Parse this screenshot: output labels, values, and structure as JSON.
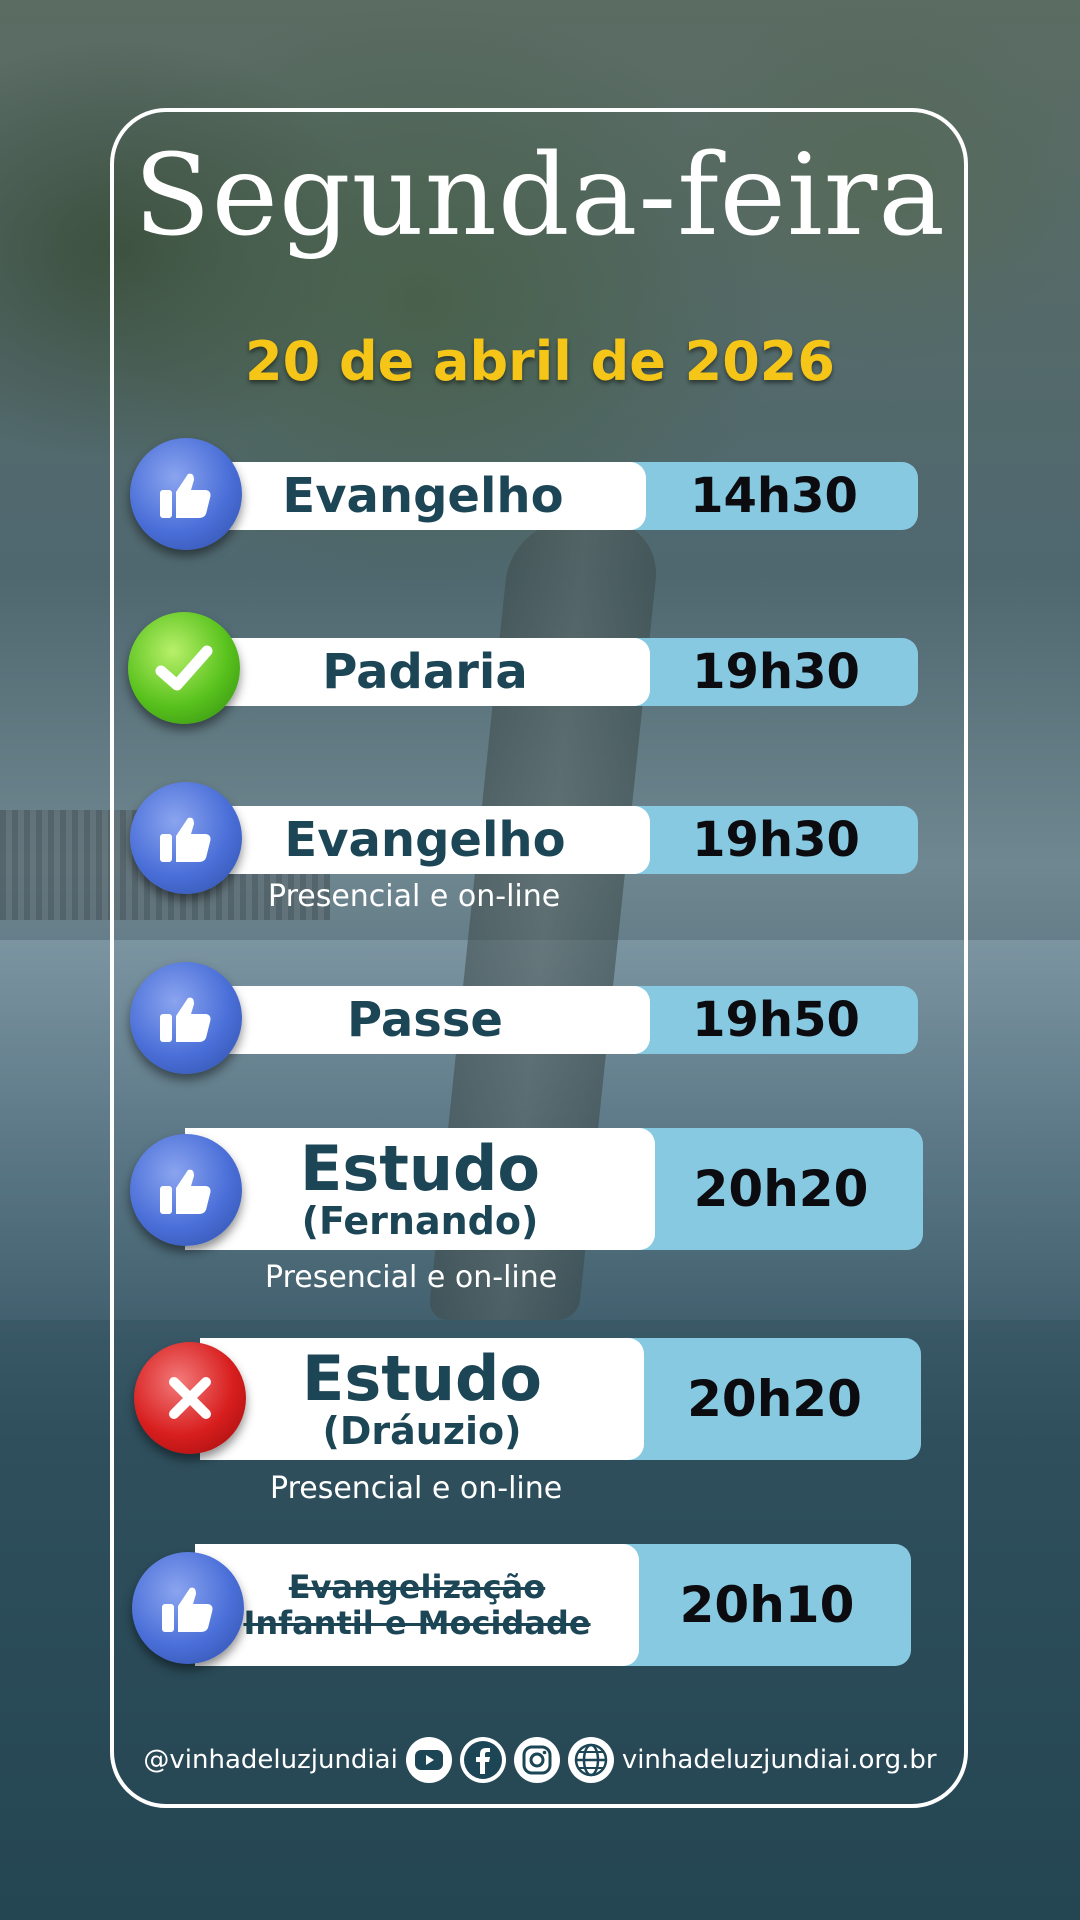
{
  "title": "Segunda-feira",
  "date": "20 de abril de 2026",
  "schedule": [
    {
      "name": "Evangelho",
      "name2": "",
      "time": "14h30",
      "note": "",
      "icon": "thumbs-up-icon"
    },
    {
      "name": "Padaria",
      "name2": "",
      "time": "19h30",
      "note": "",
      "icon": "check-icon"
    },
    {
      "name": "Evangelho",
      "name2": "",
      "time": "19h30",
      "note": "Presencial e on-line",
      "icon": "thumbs-up-icon"
    },
    {
      "name": "Passe",
      "name2": "",
      "time": "19h50",
      "note": "",
      "icon": "thumbs-up-icon"
    },
    {
      "name": "Estudo",
      "name2": "(Fernando)",
      "time": "20h20",
      "note": "Presencial e on-line",
      "icon": "thumbs-up-icon"
    },
    {
      "name": "Estudo",
      "name2": "(Dráuzio)",
      "time": "20h20",
      "note": "Presencial e on-line",
      "icon": "cross-icon"
    },
    {
      "name": "Evangelização",
      "name2": "Infantil e Mocidade",
      "time": "20h10",
      "note": "",
      "icon": "thumbs-up-icon",
      "status": "cancelled"
    }
  ],
  "footer": {
    "handle": "@vinhadeluzjundiai",
    "website": "vinhadeluzjundiai.org.br",
    "icons": [
      "youtube-icon",
      "facebook-icon",
      "instagram-icon",
      "globe-icon"
    ]
  },
  "colors": {
    "title": "#ffffff",
    "date": "#f5c518",
    "name_text": "#1c4656",
    "time_bg": "#86c9e1",
    "frame": "#ffffff"
  }
}
